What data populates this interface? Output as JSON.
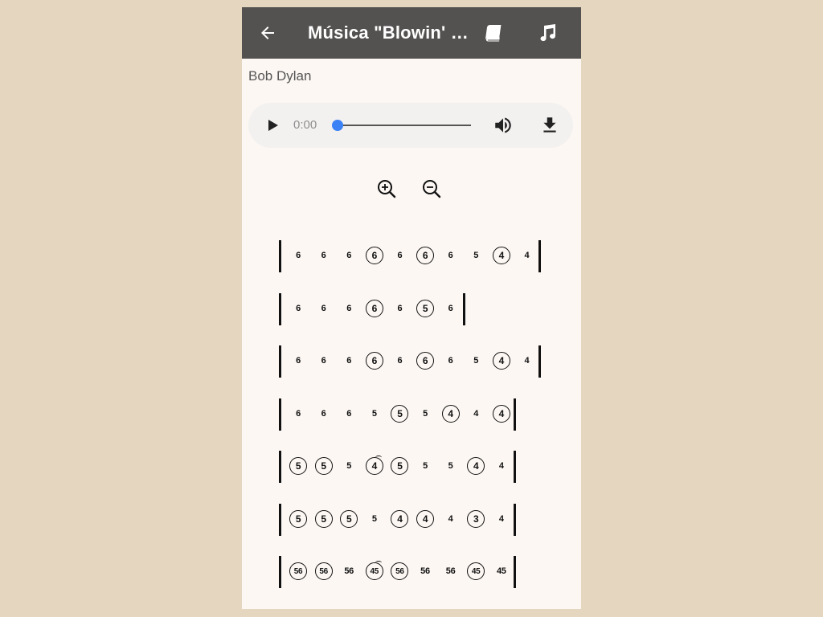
{
  "app": {
    "title": "Música \"Blowin' in the Wind\"",
    "artist": "Bob Dylan"
  },
  "icons": {
    "back": "arrow-left-icon",
    "lyrics": "book-icon",
    "music": "music-note-icon",
    "play": "play-icon",
    "volume": "volume-icon",
    "download": "download-icon",
    "zoom_in": "zoom-in-icon",
    "zoom_out": "zoom-out-icon"
  },
  "colors": {
    "appbar": "#545250",
    "background": "#fcf7f3",
    "page_background": "#e4d6bf",
    "slider_thumb": "#3b82f6"
  },
  "player": {
    "time": "0:00",
    "progress": 0
  },
  "tablature": [
    [
      {
        "n": "6",
        "c": false
      },
      {
        "n": "6",
        "c": false
      },
      {
        "n": "6",
        "c": false
      },
      {
        "n": "6",
        "c": true
      },
      {
        "n": "6",
        "c": false
      },
      {
        "n": "6",
        "c": true
      },
      {
        "n": "6",
        "c": false
      },
      {
        "n": "5",
        "c": false
      },
      {
        "n": "4",
        "c": true
      },
      {
        "n": "4",
        "c": false
      }
    ],
    [
      {
        "n": "6",
        "c": false
      },
      {
        "n": "6",
        "c": false
      },
      {
        "n": "6",
        "c": false
      },
      {
        "n": "6",
        "c": true
      },
      {
        "n": "6",
        "c": false
      },
      {
        "n": "5",
        "c": true
      },
      {
        "n": "6",
        "c": false
      }
    ],
    [
      {
        "n": "6",
        "c": false
      },
      {
        "n": "6",
        "c": false
      },
      {
        "n": "6",
        "c": false
      },
      {
        "n": "6",
        "c": true
      },
      {
        "n": "6",
        "c": false
      },
      {
        "n": "6",
        "c": true
      },
      {
        "n": "6",
        "c": false
      },
      {
        "n": "5",
        "c": false
      },
      {
        "n": "4",
        "c": true
      },
      {
        "n": "4",
        "c": false
      }
    ],
    [
      {
        "n": "6",
        "c": false
      },
      {
        "n": "6",
        "c": false
      },
      {
        "n": "6",
        "c": false
      },
      {
        "n": "5",
        "c": false
      },
      {
        "n": "5",
        "c": true
      },
      {
        "n": "5",
        "c": false
      },
      {
        "n": "4",
        "c": true
      },
      {
        "n": "4",
        "c": false
      },
      {
        "n": "4",
        "c": true
      }
    ],
    [
      {
        "n": "5",
        "c": true
      },
      {
        "n": "5",
        "c": true
      },
      {
        "n": "5",
        "c": false
      },
      {
        "n": "4",
        "c": true,
        "bend": true
      },
      {
        "n": "5",
        "c": true
      },
      {
        "n": "5",
        "c": false
      },
      {
        "n": "5",
        "c": false
      },
      {
        "n": "4",
        "c": true
      },
      {
        "n": "4",
        "c": false
      }
    ],
    [
      {
        "n": "5",
        "c": true
      },
      {
        "n": "5",
        "c": true
      },
      {
        "n": "5",
        "c": true
      },
      {
        "n": "5",
        "c": false
      },
      {
        "n": "4",
        "c": true
      },
      {
        "n": "4",
        "c": true
      },
      {
        "n": "4",
        "c": false
      },
      {
        "n": "3",
        "c": true
      },
      {
        "n": "4",
        "c": false
      }
    ],
    [
      {
        "n": "56",
        "c": true
      },
      {
        "n": "56",
        "c": true
      },
      {
        "n": "56",
        "c": false
      },
      {
        "n": "45",
        "c": true,
        "bend": true
      },
      {
        "n": "56",
        "c": true
      },
      {
        "n": "56",
        "c": false
      },
      {
        "n": "56",
        "c": false
      },
      {
        "n": "45",
        "c": true
      },
      {
        "n": "45",
        "c": false
      }
    ]
  ]
}
